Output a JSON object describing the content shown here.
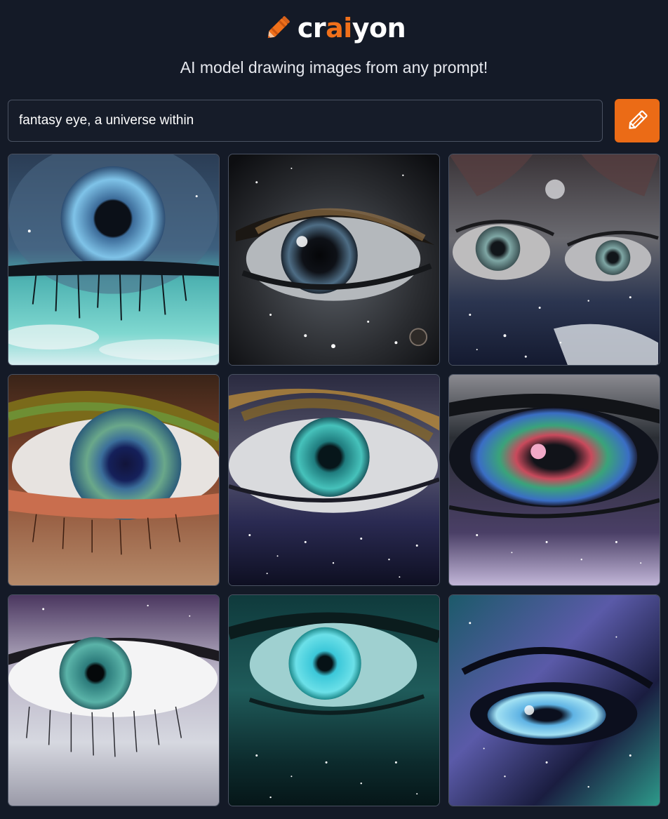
{
  "header": {
    "brand_prefix": "cr",
    "brand_accent": "ai",
    "brand_suffix": "yon",
    "subtitle": "AI model drawing images from any prompt!"
  },
  "prompt": {
    "value": "fantasy eye, a universe within",
    "placeholder": ""
  },
  "draw_button": {
    "icon": "pencil-icon"
  },
  "results": [
    {
      "name": "result-image-1",
      "theme": "teal-iris-over-cloudy-sky"
    },
    {
      "name": "result-image-2",
      "theme": "dark-iris-in-starry-skin"
    },
    {
      "name": "result-image-3",
      "theme": "two-eyes-in-galaxy"
    },
    {
      "name": "result-image-4",
      "theme": "multicolor-iris-bronze-skin"
    },
    {
      "name": "result-image-5",
      "theme": "teal-iris-galaxy-lower-lid"
    },
    {
      "name": "result-image-6",
      "theme": "nebula-iris"
    },
    {
      "name": "result-image-7",
      "theme": "teal-iris-white-sclera"
    },
    {
      "name": "result-image-8",
      "theme": "cyan-iris-green-space"
    },
    {
      "name": "result-image-9",
      "theme": "blue-iris-cosmic-face"
    }
  ],
  "colors": {
    "background": "#141a27",
    "accent": "#f0701a",
    "button": "#eb6b16",
    "border": "#4a5262"
  }
}
